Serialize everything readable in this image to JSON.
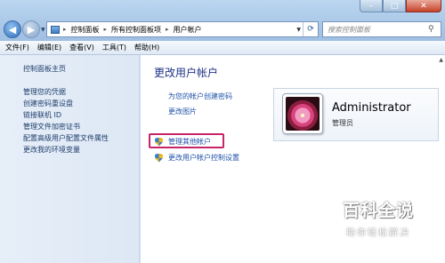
{
  "address": {
    "crumbs": [
      "控制面板",
      "所有控制面板项",
      "用户帐户"
    ],
    "search_placeholder": "搜索控制面板"
  },
  "menu": [
    "文件(F)",
    "编辑(E)",
    "查看(V)",
    "工具(T)",
    "帮助(H)"
  ],
  "sidebar": {
    "home": "控制面板主页",
    "items": [
      "管理您的凭据",
      "创建密码重设盘",
      "链接联机 ID",
      "管理文件加密证书",
      "配置高级用户配置文件属性",
      "更改我的环境变量"
    ]
  },
  "main": {
    "title": "更改用户帐户",
    "links": [
      "为您的帐户创建密码",
      "更改图片"
    ],
    "shield_links": [
      "管理其他帐户",
      "更改用户帐户控制设置"
    ]
  },
  "account": {
    "name": "Administrator",
    "role": "管理员"
  },
  "watermark": {
    "logo": "百科全说",
    "sub": "助你轻松解决"
  },
  "colors": {
    "highlight_box": "#c8246a",
    "link": "#1f51a8",
    "title": "#1e3287"
  }
}
